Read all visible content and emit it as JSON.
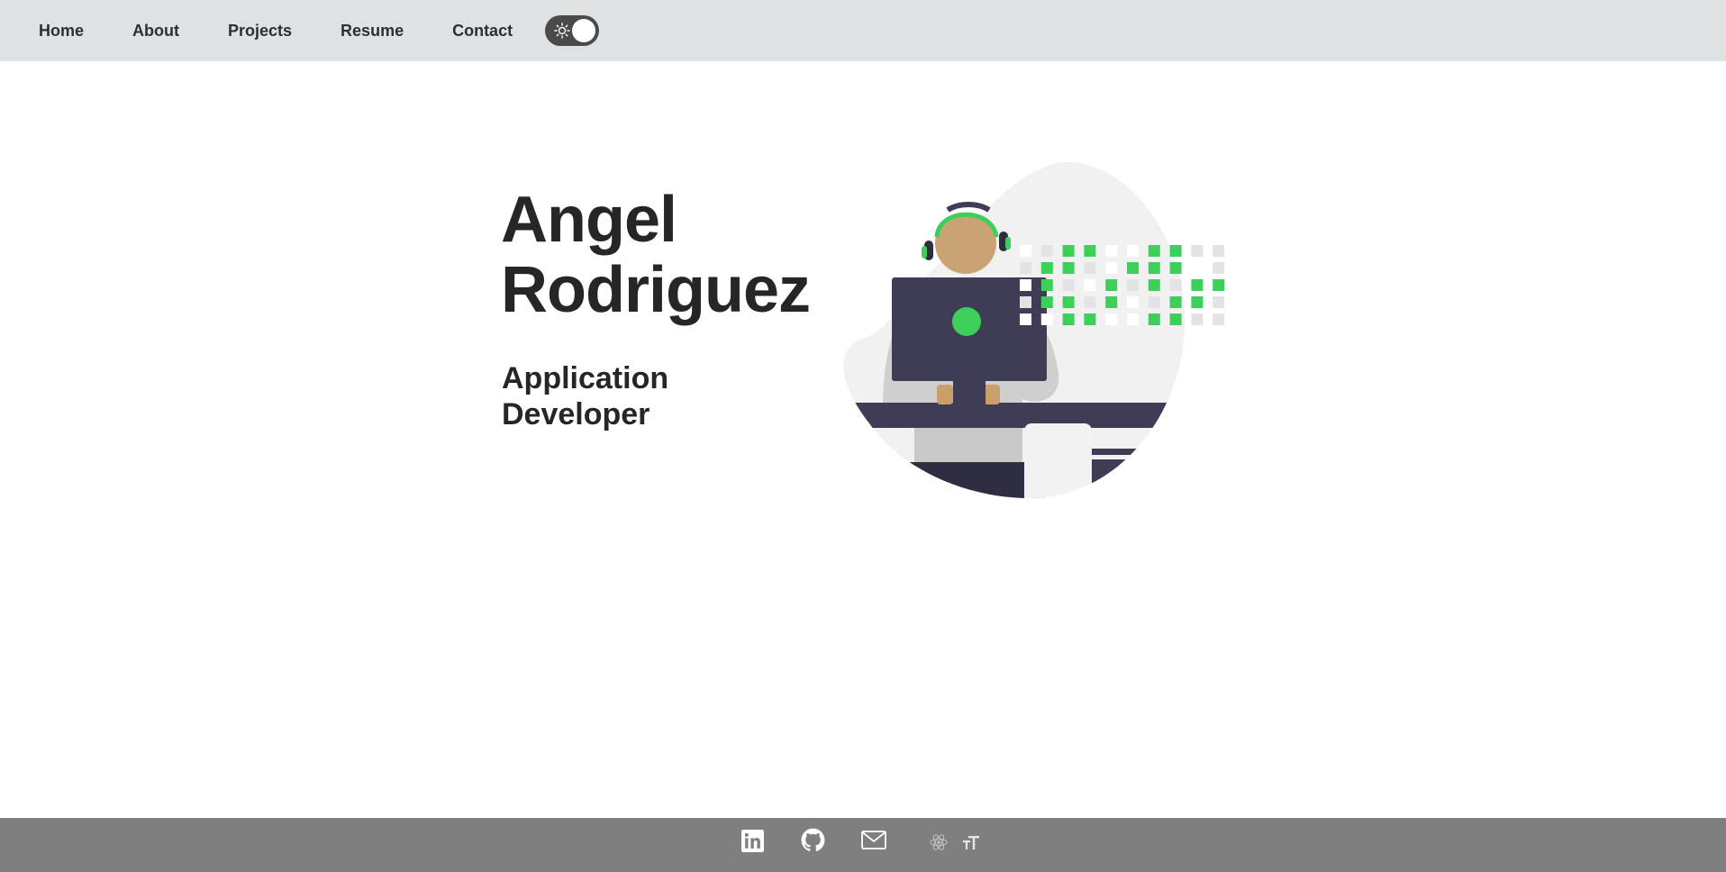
{
  "nav": {
    "items": [
      {
        "label": "Home"
      },
      {
        "label": "About"
      },
      {
        "label": "Projects"
      },
      {
        "label": "Resume"
      },
      {
        "label": "Contact"
      }
    ],
    "theme_toggle": {
      "icon": "sun-icon",
      "state": "light"
    }
  },
  "hero": {
    "name_line1": "Angel",
    "name_line2": "Rodriguez",
    "role_line1": "Application",
    "role_line2": "Developer"
  },
  "footer": {
    "icons": [
      "linkedin-icon",
      "github-icon",
      "mail-icon",
      "react-icon",
      "font-size-icon"
    ]
  },
  "colors": {
    "nav_bg": "#dfe2e5",
    "footer_bg": "#7f7f7f",
    "accent_green": "#3ecf5a",
    "monitor": "#3f3d56",
    "text": "#262626"
  }
}
